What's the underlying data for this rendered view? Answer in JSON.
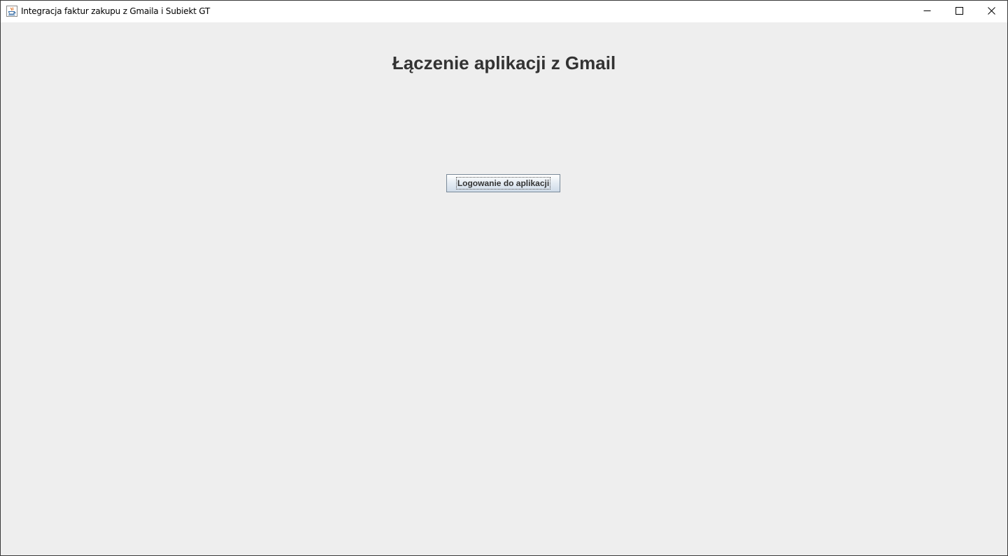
{
  "window": {
    "title": "Integracja faktur zakupu z Gmaila i Subiekt GT",
    "app_icon": "java-cup-icon",
    "controls": {
      "minimize_icon": "minimize-icon",
      "maximize_icon": "maximize-icon",
      "close_icon": "close-icon"
    }
  },
  "main": {
    "heading": "Łączenie aplikacji z Gmail",
    "login_button_label": "Logowanie do aplikacji"
  },
  "colors": {
    "background": "#eeeeee",
    "heading_text": "#333333",
    "button_border": "#7a8a99"
  }
}
